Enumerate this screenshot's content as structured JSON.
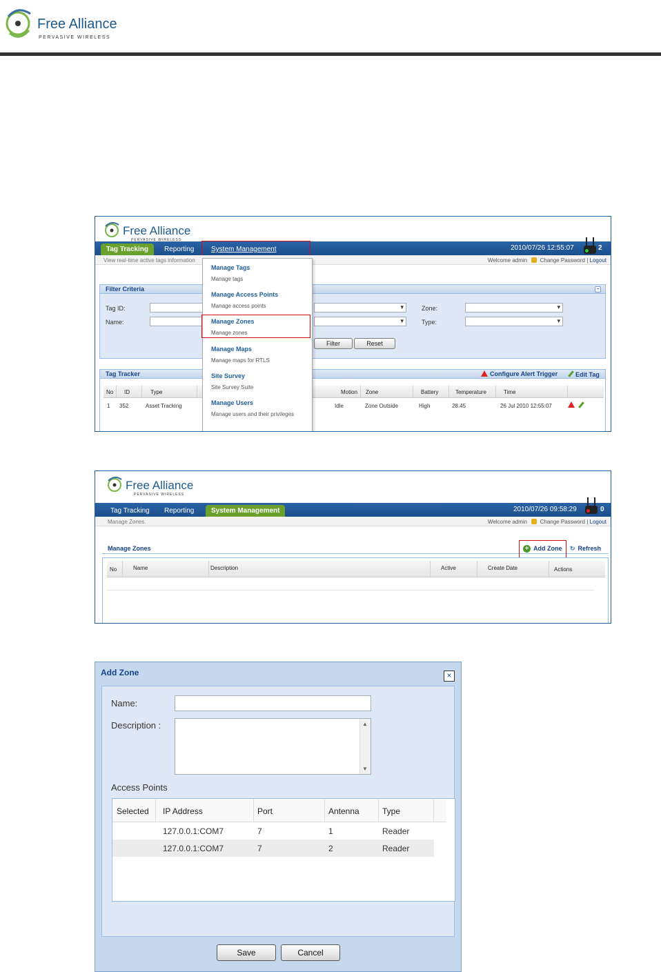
{
  "doc": {
    "logo_name": "Free Alliance",
    "logo_tagline": "PERVASIVE WIRELESS"
  },
  "shot1": {
    "logo_name": "Free Alliance",
    "logo_tagline": "PERVASIVE WIRELESS",
    "tabs": [
      "Tag Tracking",
      "Reporting",
      "System Management"
    ],
    "active_tab": "Tag Tracking",
    "datetime": "2010/07/26 12:55:07",
    "count": "2",
    "hint": "View real-time active tags information",
    "welcome": "Welcome admin",
    "change_password": "Change Password",
    "separator": "|",
    "logout": "Logout",
    "filter_title": "Filter Criteria",
    "tag_id_label": "Tag ID:",
    "name_label": "Name:",
    "zone_label": "Zone:",
    "type_label": "Type:",
    "filter_button": "Filter",
    "reset_button": "Reset",
    "tracker_title": "Tag Tracker",
    "configure_alert": "Configure Alert Trigger",
    "edit_tag": "Edit Tag",
    "columns": [
      "No",
      "ID",
      "Type",
      "Motion",
      "Zone",
      "Battery",
      "Temperature",
      "Time"
    ],
    "row": [
      "1",
      "352",
      "Asset Tracking",
      "Idle",
      "Zone Outside",
      "High",
      "28.45",
      "26 Jul 2010 12:55:07"
    ],
    "menu": [
      {
        "title": "Manage Tags",
        "desc": "Manage tags"
      },
      {
        "title": "Manage Access Points",
        "desc": "Manage access points"
      },
      {
        "title": "Manage Zones",
        "desc": "Manage zones"
      },
      {
        "title": "Manage Maps",
        "desc": "Manage maps for RTLS"
      },
      {
        "title": "Site Survey",
        "desc": "Site Survey Suite"
      },
      {
        "title": "Manage Users",
        "desc": "Manage users and their privileges"
      }
    ]
  },
  "shot2": {
    "logo_name": "Free Alliance",
    "logo_tagline": "PERVASIVE WIRELESS",
    "tabs": [
      "Tag Tracking",
      "Reporting",
      "System Management"
    ],
    "active_tab": "System Management",
    "datetime": "2010/07/26 09:58:29",
    "count": "0",
    "hint": "Manage Zones.",
    "welcome": "Welcome admin",
    "change_password": "Change Password",
    "separator": "|",
    "logout": "Logout",
    "panel_title": "Manage Zones",
    "add_zone": "Add Zone",
    "refresh": "Refresh",
    "columns": [
      "No",
      "Name",
      "Description",
      "Active",
      "Create Date",
      "Actions"
    ]
  },
  "dialog": {
    "title": "Add Zone",
    "close_symbol": "×",
    "name_label": "Name:",
    "description_label": "Description :",
    "name_value": "",
    "description_value": "",
    "access_points_label": "Access Points",
    "columns": [
      "Selected",
      "IP Address",
      "Port",
      "Antenna",
      "Type"
    ],
    "rows": [
      {
        "ip": "127.0.0.1:COM7",
        "port": "7",
        "antenna": "1",
        "type": "Reader"
      },
      {
        "ip": "127.0.0.1:COM7",
        "port": "7",
        "antenna": "2",
        "type": "Reader"
      }
    ],
    "save": "Save",
    "cancel": "Cancel"
  },
  "colors": {
    "nav_blue": "#1f5fa0",
    "active_tab_green": "#6aa12d",
    "highlight_red": "#d01010",
    "panel_blue": "#dfe8f6"
  }
}
